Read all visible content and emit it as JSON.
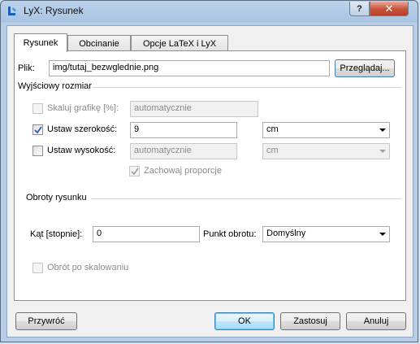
{
  "window": {
    "title": "LyX: Rysunek",
    "help_label": "?",
    "close_label": "✕"
  },
  "tabs": [
    {
      "label": "Rysunek"
    },
    {
      "label": "Obcinanie"
    },
    {
      "label": "Opcje LaTeX i LyX"
    }
  ],
  "file": {
    "label": "Plik:",
    "value": "img/tutaj_bezwglednie.png",
    "browse_label": "Przeglądaj..."
  },
  "output_size": {
    "heading": "Wyjściowy rozmiar",
    "scale_label": "Skaluj grafikę [%]:",
    "scale_value": "automatycznie",
    "scale_checked": false,
    "width_label": "Ustaw szerokość:",
    "width_value": "9",
    "width_unit": "cm",
    "width_checked": true,
    "height_label": "Ustaw wysokość:",
    "height_value": "automatycznie",
    "height_unit": "cm",
    "height_checked": false,
    "keep_ratio_label": "Zachowaj proporcje",
    "keep_ratio_checked": true
  },
  "rotation": {
    "heading": "Obroty rysunku",
    "angle_label": "Kąt [stopnie]:",
    "angle_value": "0",
    "origin_label": "Punkt obrotu:",
    "origin_value": "Domyślny",
    "after_scaling_label": "Obrót po skalowaniu",
    "after_scaling_checked": false
  },
  "footer": {
    "restore_label": "Przywróć",
    "ok_label": "OK",
    "apply_label": "Zastosuj",
    "cancel_label": "Anuluj"
  }
}
